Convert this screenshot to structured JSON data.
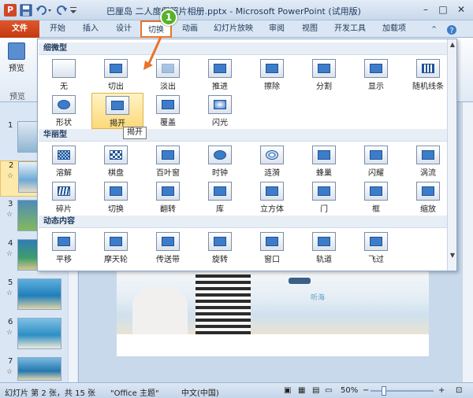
{
  "window": {
    "title": "巴厘岛 二人度假照片相册.pptx - Microsoft PowerPoint (试用版)",
    "app_icon_letter": "P"
  },
  "tabs": [
    {
      "label": "文件"
    },
    {
      "label": "开始"
    },
    {
      "label": "插入"
    },
    {
      "label": "设计"
    },
    {
      "label": "切换"
    },
    {
      "label": "动画"
    },
    {
      "label": "幻灯片放映"
    },
    {
      "label": "审阅"
    },
    {
      "label": "视图"
    },
    {
      "label": "开发工具"
    },
    {
      "label": "加载项"
    }
  ],
  "ribbon": {
    "preview_label": "预览",
    "group_label": "预览"
  },
  "callout": {
    "number": "1"
  },
  "gallery": {
    "sections": [
      {
        "title": "细微型",
        "items": [
          "无",
          "切出",
          "淡出",
          "推进",
          "擦除",
          "分割",
          "显示",
          "随机线条",
          "形状",
          "揭开",
          "覆盖",
          "闪光"
        ]
      },
      {
        "title": "华丽型",
        "items": [
          "溶解",
          "棋盘",
          "百叶窗",
          "时钟",
          "涟漪",
          "蜂巢",
          "闪耀",
          "涡流",
          "碎片",
          "切换",
          "翻转",
          "库",
          "立方体",
          "门",
          "框",
          "缩放"
        ]
      },
      {
        "title": "动态内容",
        "items": [
          "平移",
          "摩天轮",
          "传送带",
          "旋转",
          "窗口",
          "轨道",
          "飞过"
        ]
      }
    ],
    "hovered_item": "揭开",
    "tooltip": "揭开"
  },
  "slides": [
    {
      "number": "1",
      "star": ""
    },
    {
      "number": "2",
      "star": "☆"
    },
    {
      "number": "3",
      "star": "☆"
    },
    {
      "number": "4",
      "star": "☆"
    },
    {
      "number": "5",
      "star": "☆"
    },
    {
      "number": "6",
      "star": "☆"
    },
    {
      "number": "7",
      "star": "☆"
    }
  ],
  "slide_canvas": {
    "caption": "听海"
  },
  "statusbar": {
    "slide_info": "幻灯片 第 2 张，共 15 张",
    "theme": "\"Office 主题\"",
    "language": "中文(中国)",
    "zoom": "50%"
  }
}
